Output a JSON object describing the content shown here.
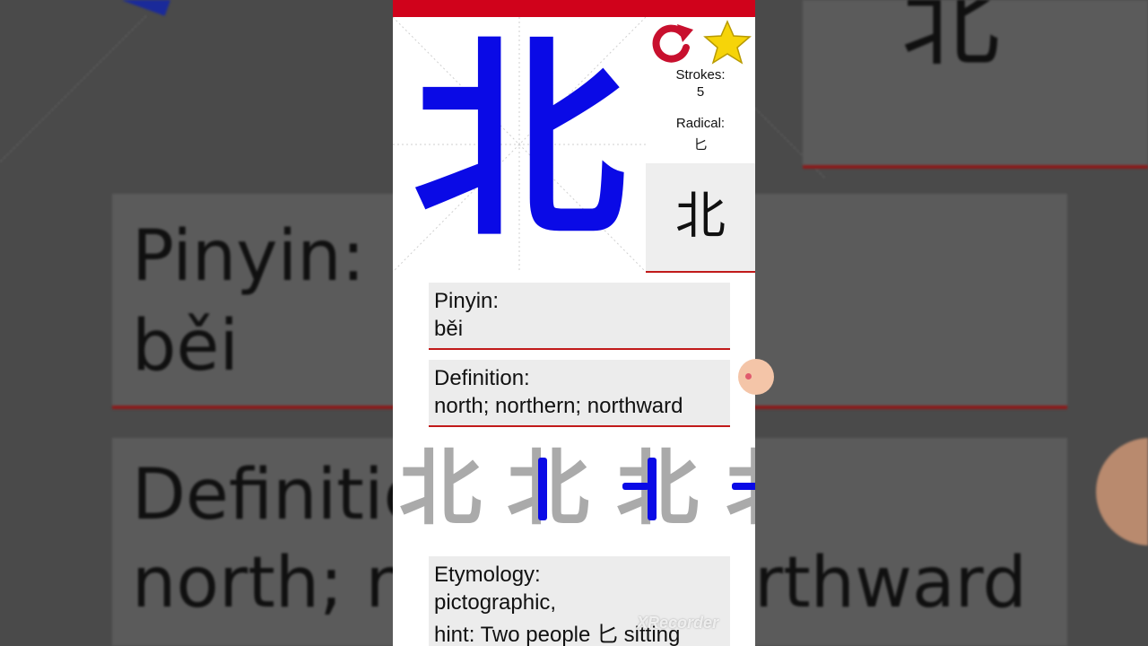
{
  "app": {
    "character": "北",
    "strokes_label": "Strokes:",
    "strokes_value": "5",
    "radical_label": "Radical:",
    "radical_value": "匕",
    "icons": {
      "reload": "reload-icon",
      "favorite": "star-icon"
    },
    "colors": {
      "accent_red": "#d0021b",
      "stroke_blue": "#0a0ae6",
      "card_bg": "#ececec"
    }
  },
  "pinyin": {
    "label": "Pinyin:",
    "value": "běi"
  },
  "definition": {
    "label": "Definition:",
    "value": "north; northern; northward"
  },
  "stroke_order": {
    "character": "北",
    "frames": [
      "北",
      "北",
      "北",
      "北"
    ]
  },
  "etymology": {
    "label": "Etymology:",
    "type": "pictographic,",
    "hint": "hint: Two people 匕 sitting"
  },
  "background": {
    "pinyin_label": "Pinyin:",
    "pinyin_value": "běi",
    "definition_label": "Definitio",
    "definition_value_start": "north; no",
    "definition_value_end": "rthward",
    "character": "北"
  },
  "watermark": "XRecorder"
}
